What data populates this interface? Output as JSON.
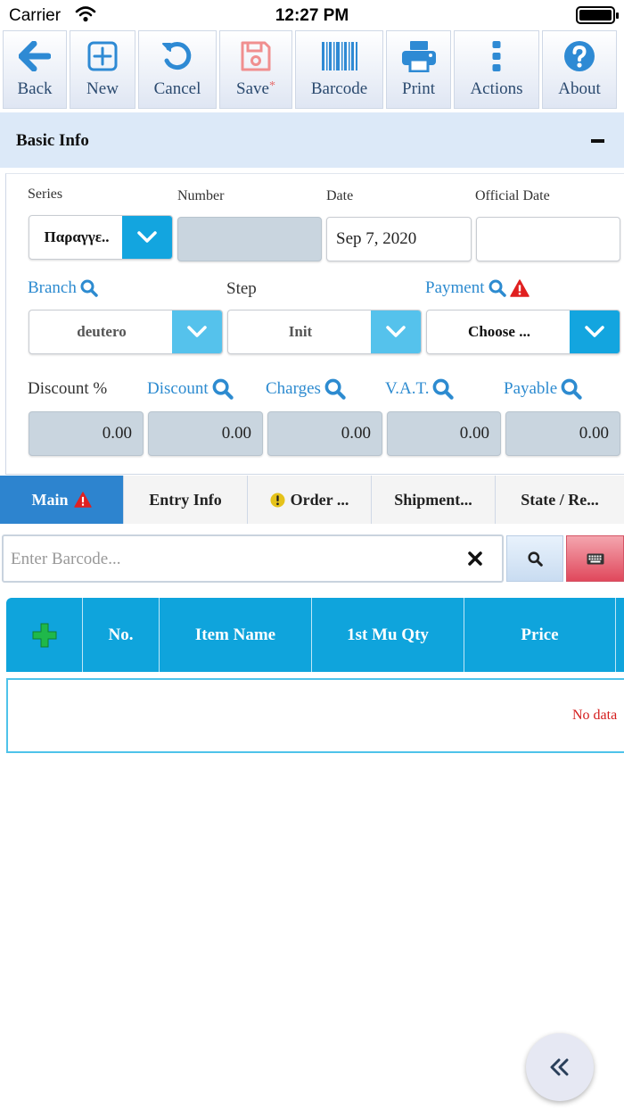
{
  "status_bar": {
    "carrier": "Carrier",
    "time": "12:27 PM"
  },
  "toolbar": {
    "items": [
      {
        "label": "Back",
        "icon": "arrow-left-icon"
      },
      {
        "label": "New",
        "icon": "plus-square-icon"
      },
      {
        "label": "Cancel",
        "icon": "undo-icon"
      },
      {
        "label": "Save",
        "icon": "floppy-disk-icon",
        "modified_mark": "*"
      },
      {
        "label": "Barcode",
        "icon": "barcode-icon"
      },
      {
        "label": "Print",
        "icon": "printer-icon"
      },
      {
        "label": "Actions",
        "icon": "vertical-dots-icon"
      },
      {
        "label": "About",
        "icon": "question-circle-icon"
      }
    ]
  },
  "basic_info": {
    "title": "Basic Info",
    "series": {
      "label": "Series",
      "value": "Παραγγε.."
    },
    "number": {
      "label": "Number",
      "value": ""
    },
    "date": {
      "label": "Date",
      "value": "Sep 7, 2020"
    },
    "official_date": {
      "label": "Official Date",
      "value": ""
    },
    "branch": {
      "label": "Branch",
      "value": "deutero"
    },
    "step": {
      "label": "Step",
      "value": "Init"
    },
    "payment": {
      "label": "Payment",
      "value": "Choose ..."
    },
    "discount_pct": {
      "label": "Discount %",
      "value": "0.00"
    },
    "discount": {
      "label": "Discount",
      "value": "0.00"
    },
    "charges": {
      "label": "Charges",
      "value": "0.00"
    },
    "vat": {
      "label": "V.A.T.",
      "value": "0.00"
    },
    "payable": {
      "label": "Payable",
      "value": "0.00"
    }
  },
  "tabs": [
    {
      "label": "Main",
      "active": true
    },
    {
      "label": "Entry Info",
      "active": false
    },
    {
      "label": "Order ...",
      "active": false
    },
    {
      "label": "Shipment...",
      "active": false
    },
    {
      "label": "State / Re...",
      "active": false
    }
  ],
  "barcode": {
    "placeholder": "Enter Barcode..."
  },
  "grid": {
    "columns": [
      "No.",
      "Item Name",
      "1st Mu Qty",
      "Price"
    ],
    "empty_text": "No data"
  },
  "colors": {
    "accent": "#0fa4dc",
    "link": "#2d8bd0",
    "active_tab": "#2d84cf",
    "warning": "#e02020",
    "header_bg": "#dce9f8"
  }
}
